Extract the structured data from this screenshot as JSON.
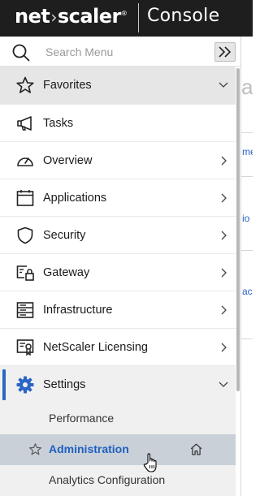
{
  "header": {
    "brand_left": "net",
    "brand_right": "scaler",
    "brand_mark": "›",
    "brand_reg": "®",
    "title": "Console"
  },
  "search": {
    "placeholder": "Search Menu"
  },
  "menu": {
    "items": [
      {
        "label": "Favorites",
        "icon": "star-icon",
        "chevron": "down"
      },
      {
        "label": "Tasks",
        "icon": "megaphone-icon",
        "chevron": "none"
      },
      {
        "label": "Overview",
        "icon": "gauge-icon",
        "chevron": "right"
      },
      {
        "label": "Applications",
        "icon": "calendar-window-icon",
        "chevron": "right"
      },
      {
        "label": "Security",
        "icon": "shield-icon",
        "chevron": "right"
      },
      {
        "label": "Gateway",
        "icon": "gateway-lock-icon",
        "chevron": "right"
      },
      {
        "label": "Infrastructure",
        "icon": "server-rack-icon",
        "chevron": "right"
      },
      {
        "label": "NetScaler Licensing",
        "icon": "certificate-icon",
        "chevron": "right"
      },
      {
        "label": "Settings",
        "icon": "gear-icon",
        "chevron": "down"
      }
    ],
    "settings_sub": [
      {
        "label": "Performance"
      },
      {
        "label": "Administration"
      },
      {
        "label": "Analytics Configuration"
      }
    ]
  },
  "right_pane": {
    "fragments": [
      "at",
      "me",
      "io",
      "ac"
    ]
  },
  "colors": {
    "topbar": "#1e1e1e",
    "accent": "#2a66c5",
    "active_row": "#c9d0d8",
    "favorites_row": "#e6e6e6"
  }
}
